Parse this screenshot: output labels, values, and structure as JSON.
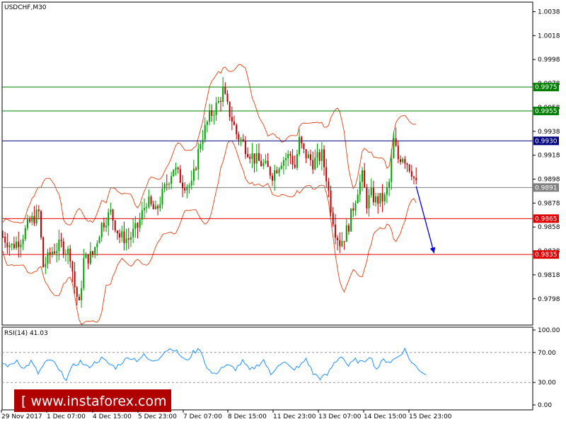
{
  "symbol_label": "USDCHF,M30",
  "rsi_label": "RSI(14) 41.03",
  "watermark": "[ www.instaforex.com ]",
  "colors": {
    "bull": "#00a000",
    "bear": "#c00000",
    "band": "#e04010",
    "resistance": "#008000",
    "pivot": "#000080",
    "current": "#808080",
    "support": "#e00000",
    "arrow": "#0000e0",
    "rsi": "#1e90ff",
    "watermark_bg": "#b00000"
  },
  "chart_data": {
    "type": "line",
    "price_axis": {
      "ylim": [
        0.9776,
        1.0046
      ],
      "ticks": [
        "1.0038",
        "1.0018",
        "0.9998",
        "0.9978",
        "0.9958",
        "0.9938",
        "0.9918",
        "0.9898",
        "0.9878",
        "0.9858",
        "0.9838",
        "0.9818",
        "0.9798"
      ]
    },
    "time_labels": [
      "29 Nov 2017",
      "1 Dec 07:00",
      "4 Dec 15:00",
      "5 Dec 23:00",
      "7 Dec 07:00",
      "8 Dec 15:00",
      "11 Dec 23:00",
      "13 Dec 07:00",
      "14 Dec 15:00",
      "15 Dec 23:00"
    ],
    "levels": [
      {
        "name": "resistance-2",
        "value": 0.9975,
        "label": "0.9975",
        "kind": "resistance"
      },
      {
        "name": "resistance-1",
        "value": 0.9955,
        "label": "0.9955",
        "kind": "resistance"
      },
      {
        "name": "pivot",
        "value": 0.993,
        "label": "0.9930",
        "kind": "pivot"
      },
      {
        "name": "current-price",
        "value": 0.9891,
        "label": "0.9891",
        "kind": "current"
      },
      {
        "name": "support-1",
        "value": 0.9865,
        "label": "0.9865",
        "kind": "support"
      },
      {
        "name": "support-2",
        "value": 0.9835,
        "label": "0.9835",
        "kind": "support"
      }
    ],
    "price_path": [
      [
        0,
        0.985
      ],
      [
        2,
        0.9842
      ],
      [
        4,
        0.9848
      ],
      [
        6,
        0.9862
      ],
      [
        8,
        0.987
      ],
      [
        9,
        0.9825
      ],
      [
        11,
        0.9838
      ],
      [
        13,
        0.9843
      ],
      [
        15,
        0.9835
      ],
      [
        16,
        0.9808
      ],
      [
        17,
        0.9792
      ],
      [
        18,
        0.983
      ],
      [
        20,
        0.9835
      ],
      [
        22,
        0.986
      ],
      [
        24,
        0.987
      ],
      [
        26,
        0.985
      ],
      [
        28,
        0.9848
      ],
      [
        30,
        0.9858
      ],
      [
        32,
        0.988
      ],
      [
        34,
        0.987
      ],
      [
        36,
        0.989
      ],
      [
        38,
        0.9908
      ],
      [
        40,
        0.9895
      ],
      [
        42,
        0.9892
      ],
      [
        44,
        0.993
      ],
      [
        46,
        0.995
      ],
      [
        48,
        0.9962
      ],
      [
        49,
        0.9972
      ],
      [
        50,
        0.9958
      ],
      [
        51,
        0.9948
      ],
      [
        52,
        0.9936
      ],
      [
        54,
        0.9925
      ],
      [
        56,
        0.9915
      ],
      [
        58,
        0.991
      ],
      [
        60,
        0.9902
      ],
      [
        62,
        0.9914
      ],
      [
        64,
        0.9918
      ],
      [
        65,
        0.9908
      ],
      [
        66,
        0.993
      ],
      [
        67,
        0.992
      ],
      [
        69,
        0.9912
      ],
      [
        71,
        0.9918
      ],
      [
        72,
        0.99
      ],
      [
        73,
        0.9875
      ],
      [
        74,
        0.9855
      ],
      [
        75,
        0.9845
      ],
      [
        76,
        0.985
      ],
      [
        77,
        0.986
      ],
      [
        78,
        0.9875
      ],
      [
        79,
        0.989
      ],
      [
        80,
        0.99
      ],
      [
        81,
        0.9878
      ],
      [
        82,
        0.9885
      ],
      [
        83,
        0.988
      ],
      [
        85,
        0.9882
      ],
      [
        86,
        0.9895
      ],
      [
        87,
        0.993
      ],
      [
        88,
        0.9915
      ],
      [
        89,
        0.9918
      ],
      [
        90,
        0.9912
      ],
      [
        91,
        0.9905
      ],
      [
        92,
        0.9893
      ]
    ],
    "forecast_arrow": {
      "from": [
        92,
        0.9892
      ],
      "to": [
        96,
        0.9836
      ]
    },
    "rsi": {
      "ylim": [
        0,
        100
      ],
      "ticks": [
        "100.00",
        "70.00",
        "30.00",
        "0.00"
      ],
      "levels": [
        70,
        30
      ],
      "values": [
        55,
        52,
        60,
        48,
        58,
        42,
        56,
        60,
        45,
        35,
        52,
        58,
        50,
        56,
        62,
        55,
        50,
        58,
        64,
        60,
        66,
        58,
        62,
        72,
        76,
        68,
        58,
        70,
        75,
        48,
        40,
        50,
        52,
        48,
        58,
        46,
        52,
        60,
        40,
        54,
        56,
        48,
        50,
        62,
        42,
        36,
        40,
        56,
        66,
        52,
        60,
        56,
        66,
        48,
        60,
        58,
        64,
        74,
        56,
        48,
        40
      ]
    }
  }
}
